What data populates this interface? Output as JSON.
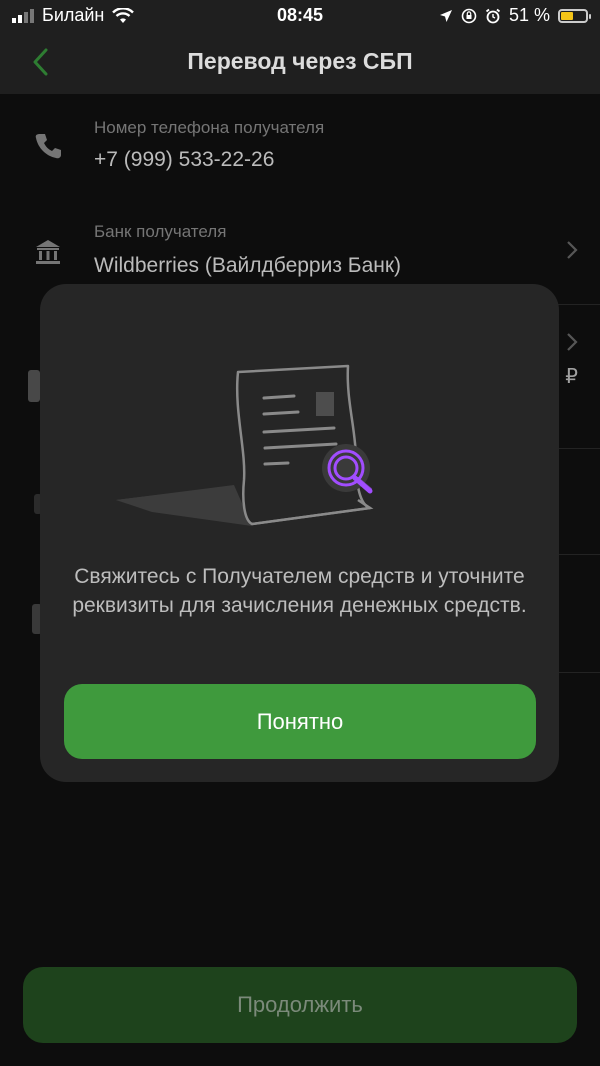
{
  "status_bar": {
    "carrier": "Билайн",
    "time": "08:45",
    "battery": "51 %",
    "battery_level": 0.51
  },
  "header": {
    "title": "Перевод через СБП",
    "back_icon": "chevron-left-icon"
  },
  "form": {
    "phone": {
      "label": "Номер телефона получателя",
      "value": "+7 (999) 533-22-26",
      "icon": "phone-icon"
    },
    "bank": {
      "label": "Банк получателя",
      "value": "Wildberries (Вайлдберриз Банк)",
      "icon": "bank-icon"
    },
    "currency_symbol": "₽"
  },
  "modal": {
    "message": "Свяжитесь с Получателем средств и уточните реквизиты для зачисления денежных средств.",
    "ok_label": "Понятно",
    "illustration": "document-search-icon"
  },
  "footer": {
    "continue_label": "Продолжить"
  },
  "colors": {
    "accent": "#3f9a3d",
    "accent_disabled": "#1e431c",
    "magnifier": "#a14dff"
  }
}
